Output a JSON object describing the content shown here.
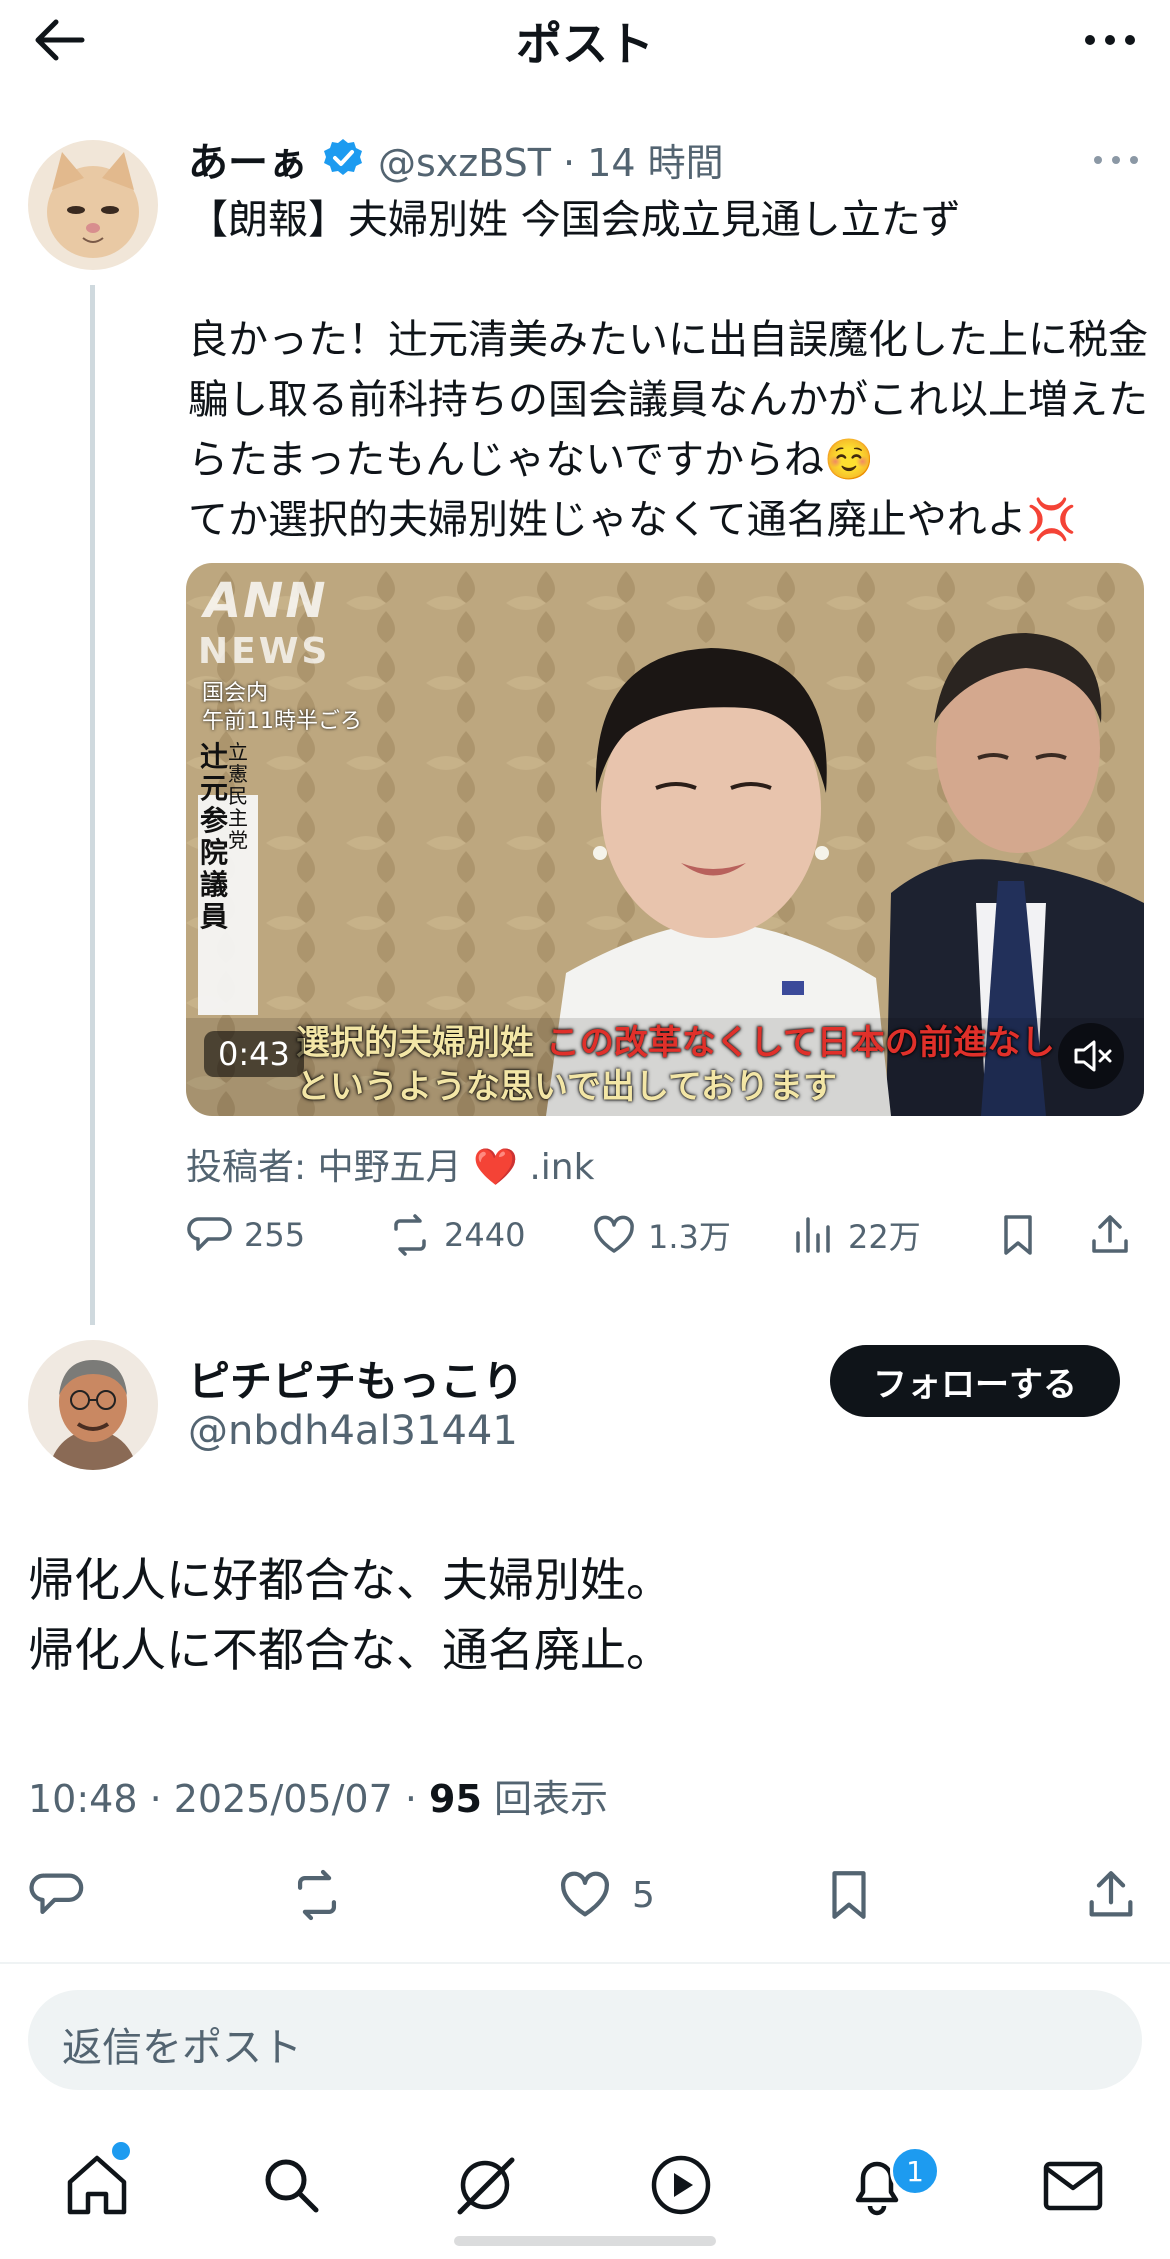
{
  "header": {
    "title": "ポスト"
  },
  "quoted": {
    "name": "あーぁ",
    "handle_time": "@sxzBST · 14 時間",
    "text": "【朗報】夫婦別姓 今国会成立見通し立たず\n\n良かった！辻元清美みたいに出自誤魔化した上に税金騙し取る前科持ちの国会議員なんかがこれ以上増えたらたまったもんじゃないですからね☺️\nてか選択的夫婦別姓じゃなくて通名廃止やれよ💢",
    "video": {
      "logo_top": "ANN",
      "logo_bottom": "NEWS",
      "location": "国会内",
      "time": "午前11時半ごろ",
      "party": "立憲民主党",
      "name_plate": "辻元参院議員",
      "caption_1a": "選択的夫婦別姓",
      "caption_1b": "この改革なくして日本の前進なし",
      "caption_2": "というような思いで出しております",
      "duration": "0:43"
    },
    "attribution_prefix": "投稿者: 中野五月",
    "attribution_emoji": "❤️",
    "attribution_suffix": ".ink",
    "stats": {
      "replies": "255",
      "reposts": "2440",
      "likes": "1.3万",
      "views": "22万"
    }
  },
  "main": {
    "name": "ピチピチもっこり",
    "handle": "@nbdh4al31441",
    "follow_label": "フォローする",
    "text": "帰化人に好都合な、夫婦別姓。\n帰化人に不都合な、通名廃止。",
    "time_date": "10:48 · 2025/05/07 · ",
    "views_count": "95",
    "views_label": " 回表示",
    "likes": "5"
  },
  "reply": {
    "placeholder": "返信をポスト"
  },
  "nav": {
    "notifications_badge": "1"
  },
  "colors": {
    "accent": "#1d9bf0",
    "text": "#0f1419",
    "muted": "#536471",
    "caption_red": "#e0302a"
  }
}
